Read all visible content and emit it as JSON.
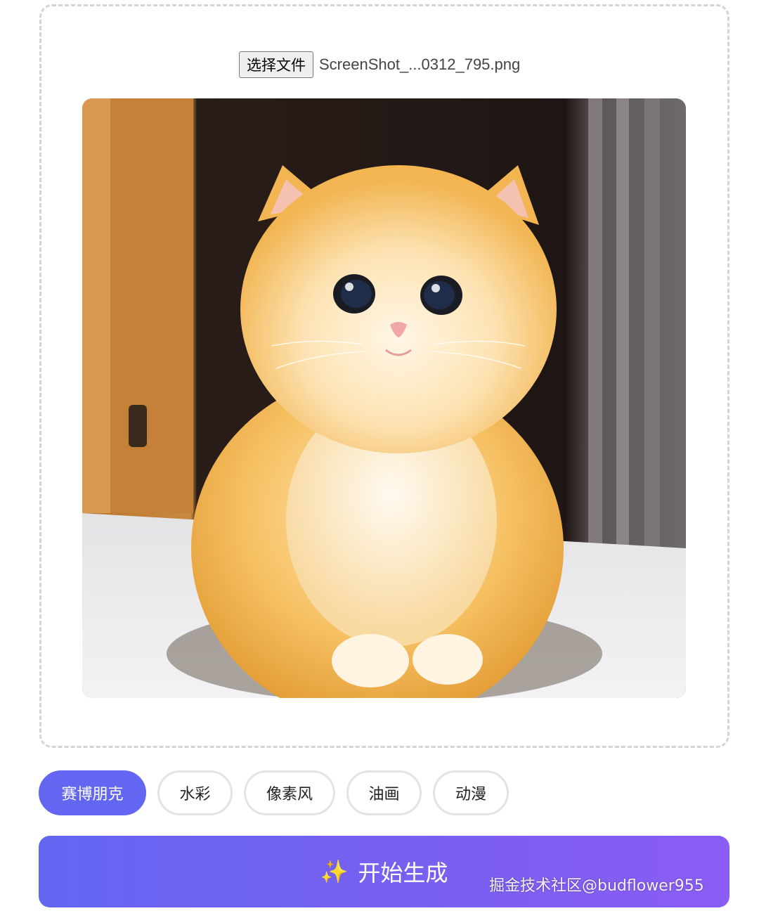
{
  "upload": {
    "choose_file_label": "选择文件",
    "file_name": "ScreenShot_...0312_795.png"
  },
  "preview": {
    "subject": "orange-kitten-photo"
  },
  "styles": [
    {
      "label": "赛博朋克",
      "active": true
    },
    {
      "label": "水彩",
      "active": false
    },
    {
      "label": "像素风",
      "active": false
    },
    {
      "label": "油画",
      "active": false
    },
    {
      "label": "动漫",
      "active": false
    }
  ],
  "generate": {
    "icon": "sparkles-icon",
    "label": "开始生成"
  },
  "watermark": "掘金技术社区@budflower955",
  "colors": {
    "accent": "#6366f1",
    "gradient_end": "#8b5cf6",
    "dashed_border": "#d4d4d4",
    "pill_border": "#e3e3e3"
  }
}
